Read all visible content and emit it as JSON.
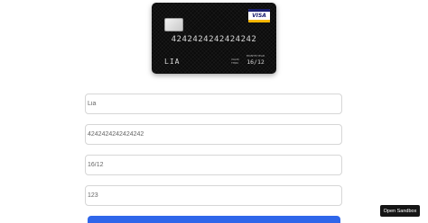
{
  "card": {
    "brand": "VISA",
    "number": "4242424242424242",
    "holder": "LIA",
    "valid_label": "VALID THRU",
    "expiry_label": "MONTH/YEAR",
    "expiry": "16/12"
  },
  "form": {
    "name_value": "Lia",
    "number_value": "4242424242424242",
    "expiry_value": "16/12",
    "cvc_value": "123"
  },
  "colors": {
    "submit_button": "#2f66ea",
    "card_background": "#0b0b0b",
    "visa_blue": "#1a1f71",
    "visa_gold": "#f7b600"
  },
  "sandbox": {
    "label": "Open Sandbox"
  }
}
